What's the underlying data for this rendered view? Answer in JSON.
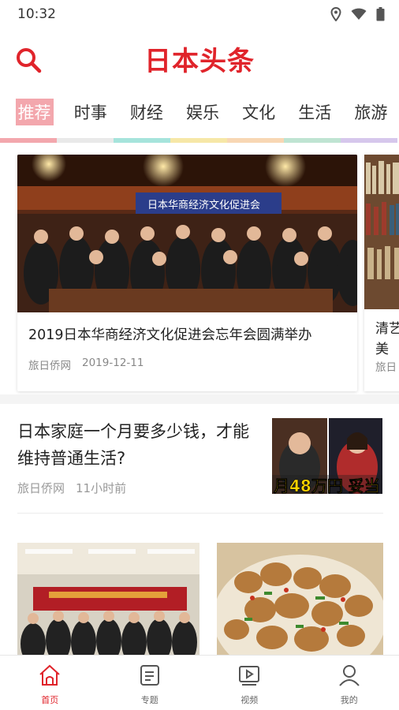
{
  "status_bar": {
    "time": "10:32",
    "icons": [
      "location-icon",
      "wifi-icon",
      "battery-icon"
    ]
  },
  "header": {
    "logo_text": "日本头条",
    "search_icon": "search-icon",
    "brand_color": "#e0242b"
  },
  "tabs": [
    {
      "label": "推荐",
      "active": true,
      "strip_color": "#f3a7ad"
    },
    {
      "label": "时事",
      "active": false,
      "strip_color": "#e9e9e9"
    },
    {
      "label": "财经",
      "active": false,
      "strip_color": "#a6e4dc"
    },
    {
      "label": "娱乐",
      "active": false,
      "strip_color": "#f6e7a7"
    },
    {
      "label": "文化",
      "active": false,
      "strip_color": "#f8d7b4"
    },
    {
      "label": "生活",
      "active": false,
      "strip_color": "#bfe4d2"
    },
    {
      "label": "旅游",
      "active": false,
      "strip_color": "#d6c7ec"
    }
  ],
  "featured": [
    {
      "title": "2019日本华商经济文化促进会忘年会圆满举办",
      "source": "旅日侨网",
      "date": "2019-12-11",
      "banner_text": "日本华商经济文化促进会"
    },
    {
      "title": "清艺美",
      "source": "旅日"
    }
  ],
  "list_items": [
    {
      "title": "日本家庭一个月要多少钱，才能维持普通生活?",
      "source": "旅日侨网",
      "time": "11小时前",
      "thumb_caption": "月48万円 妥当"
    }
  ],
  "bottom_nav": [
    {
      "label": "首页",
      "icon": "home-icon",
      "active": true
    },
    {
      "label": "专题",
      "icon": "topic-icon",
      "active": false
    },
    {
      "label": "视频",
      "icon": "video-icon",
      "active": false
    },
    {
      "label": "我的",
      "icon": "profile-icon",
      "active": false
    }
  ]
}
